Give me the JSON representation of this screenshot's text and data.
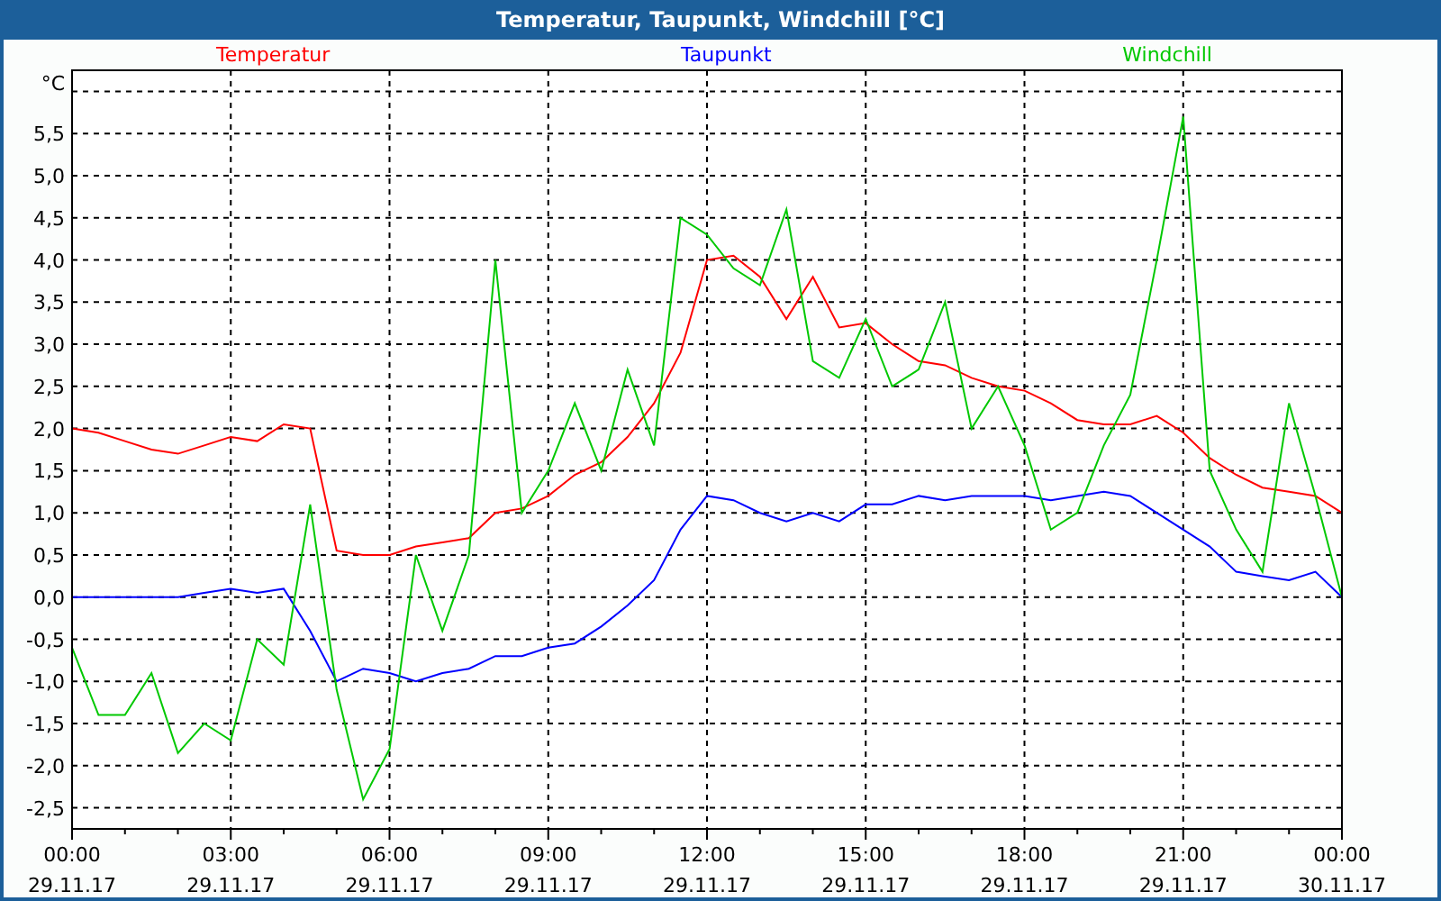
{
  "window": {
    "title": "Temperatur, Taupunkt, Windchill [°C]"
  },
  "chart": {
    "unit": "°C",
    "chart_data": {
      "type": "line",
      "x": [
        0,
        0.5,
        1,
        1.5,
        2,
        2.5,
        3,
        3.5,
        4,
        4.5,
        5,
        5.5,
        6,
        6.5,
        7,
        7.5,
        8,
        8.5,
        9,
        9.5,
        10,
        10.5,
        11,
        11.5,
        12,
        12.5,
        13,
        13.5,
        14,
        14.5,
        15,
        15.5,
        16,
        16.5,
        17,
        17.5,
        18,
        18.5,
        19,
        19.5,
        20,
        20.5,
        21,
        21.5,
        22,
        22.5,
        23,
        23.5,
        24
      ],
      "series": [
        {
          "name": "Temperatur",
          "color": "#ff0000",
          "values": [
            2.0,
            1.95,
            1.85,
            1.75,
            1.7,
            1.8,
            1.9,
            1.85,
            2.05,
            2.0,
            0.55,
            0.5,
            0.5,
            0.6,
            0.65,
            0.7,
            1.0,
            1.05,
            1.2,
            1.45,
            1.6,
            1.9,
            2.3,
            2.9,
            4.0,
            4.05,
            3.8,
            3.3,
            3.8,
            3.2,
            3.25,
            3.0,
            2.8,
            2.75,
            2.6,
            2.5,
            2.45,
            2.3,
            2.1,
            2.05,
            2.05,
            2.15,
            1.95,
            1.65,
            1.45,
            1.3,
            1.25,
            1.2,
            1.0
          ]
        },
        {
          "name": "Taupunkt",
          "color": "#0000ff",
          "values": [
            0,
            0,
            0,
            0,
            0,
            0.05,
            0.1,
            0.05,
            0.1,
            -0.4,
            -1.0,
            -0.85,
            -0.9,
            -1.0,
            -0.9,
            -0.85,
            -0.7,
            -0.7,
            -0.6,
            -0.55,
            -0.35,
            -0.1,
            0.2,
            0.8,
            1.2,
            1.15,
            1.0,
            0.9,
            1.0,
            0.9,
            1.1,
            1.1,
            1.2,
            1.15,
            1.2,
            1.2,
            1.2,
            1.15,
            1.2,
            1.25,
            1.2,
            1.0,
            0.8,
            0.6,
            0.3,
            0.25,
            0.2,
            0.3,
            0.0
          ]
        },
        {
          "name": "Windchill",
          "color": "#00c800",
          "values": [
            -0.6,
            -1.4,
            -1.4,
            -0.9,
            -1.85,
            -1.5,
            -1.7,
            -0.5,
            -0.8,
            1.1,
            -1.1,
            -2.4,
            -1.8,
            0.5,
            -0.4,
            0.5,
            4.0,
            1.0,
            1.5,
            2.3,
            1.5,
            2.7,
            1.8,
            4.5,
            4.3,
            3.9,
            3.7,
            4.6,
            2.8,
            2.6,
            3.3,
            2.5,
            2.7,
            3.5,
            2.0,
            2.5,
            1.8,
            0.8,
            1.0,
            1.8,
            2.4,
            4.0,
            5.7,
            1.5,
            0.8,
            0.3,
            2.3,
            1.2,
            0.0
          ]
        }
      ],
      "xlim": [
        0,
        24
      ],
      "ylim": [
        -2.75,
        6.25
      ],
      "grid": true,
      "xticks": [
        {
          "value": 0,
          "label": "00:00"
        },
        {
          "value": 3,
          "label": "03:00"
        },
        {
          "value": 6,
          "label": "06:00"
        },
        {
          "value": 9,
          "label": "09:00"
        },
        {
          "value": 12,
          "label": "12:00"
        },
        {
          "value": 15,
          "label": "15:00"
        },
        {
          "value": 18,
          "label": "18:00"
        },
        {
          "value": 21,
          "label": "21:00"
        },
        {
          "value": 24,
          "label": "00:00"
        }
      ],
      "yticks": [
        {
          "value": -2.5,
          "label": "-2,5"
        },
        {
          "value": -2,
          "label": "-2,0"
        },
        {
          "value": -1.5,
          "label": "-1,5"
        },
        {
          "value": -1,
          "label": "-1,0"
        },
        {
          "value": -0.5,
          "label": "-0,5"
        },
        {
          "value": 0,
          "label": "0,0"
        },
        {
          "value": 0.5,
          "label": "0,5"
        },
        {
          "value": 1,
          "label": "1,0"
        },
        {
          "value": 1.5,
          "label": "1,5"
        },
        {
          "value": 2,
          "label": "2,0"
        },
        {
          "value": 2.5,
          "label": "2,5"
        },
        {
          "value": 3,
          "label": "3,0"
        },
        {
          "value": 3.5,
          "label": "3,5"
        },
        {
          "value": 4,
          "label": "4,0"
        },
        {
          "value": 4.5,
          "label": "4,5"
        },
        {
          "value": 5,
          "label": "5,0"
        },
        {
          "value": 5.5,
          "label": "5,5"
        }
      ]
    },
    "x_dates": [
      "29.11.17",
      "29.11.17",
      "29.11.17",
      "29.11.17",
      "29.11.17",
      "29.11.17",
      "29.11.17",
      "29.11.17",
      "30.11.17"
    ]
  }
}
